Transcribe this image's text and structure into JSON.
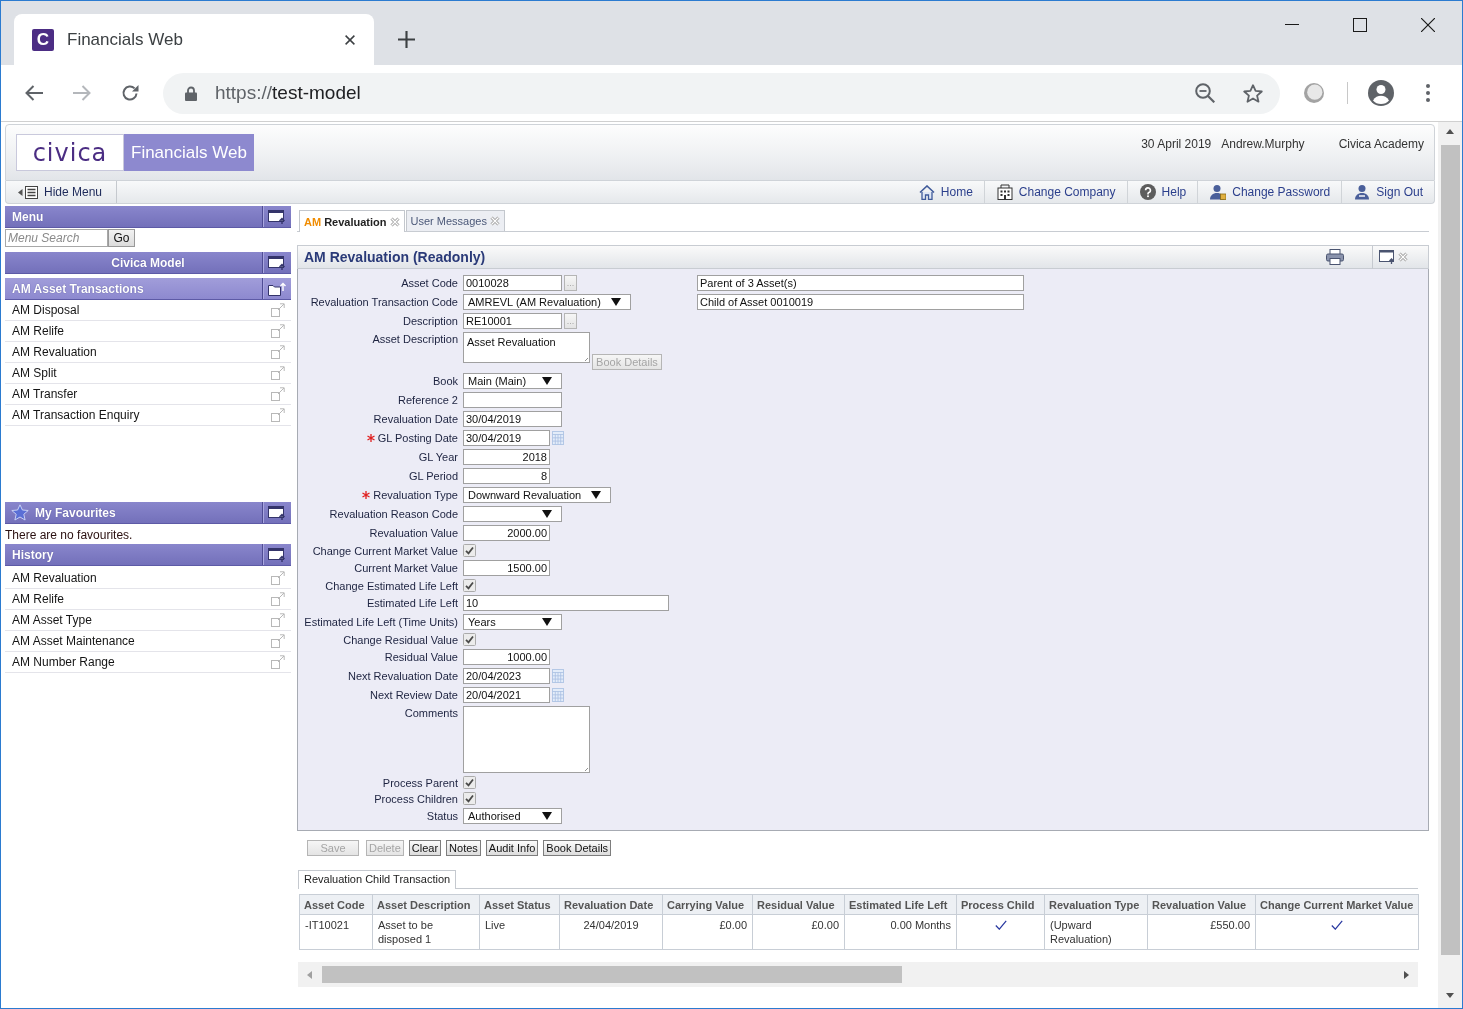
{
  "browser": {
    "tabs": [
      {
        "icon_text": "C",
        "title": "Financials Web",
        "selected": true
      }
    ],
    "url": {
      "scheme": "https://",
      "host": "test-model"
    }
  },
  "header": {
    "logo": "civica",
    "app_name": "Financials Web",
    "date": "30 April 2019",
    "user": "Andrew.Murphy",
    "organisation": "Civica Academy"
  },
  "nav": {
    "hide_menu": "Hide Menu",
    "links": [
      "Home",
      "Change Company",
      "Help",
      "Change Password",
      "Sign Out"
    ]
  },
  "sidebar": {
    "menu_title": "Menu",
    "search": {
      "placeholder": "Menu Search",
      "button": "Go"
    },
    "company": "Civica Model",
    "section": {
      "title": "AM Asset Transactions",
      "items": [
        "AM Disposal",
        "AM Relife",
        "AM Revaluation",
        "AM Split",
        "AM Transfer",
        "AM Transaction Enquiry"
      ]
    },
    "favourites": {
      "title": "My Favourites",
      "empty_text": "There are no favourites."
    },
    "history": {
      "title": "History",
      "items": [
        "AM Revaluation",
        "AM Relife",
        "AM Asset Type",
        "AM Asset Maintenance",
        "AM Number Range"
      ]
    }
  },
  "tabs": [
    {
      "prefix": "AM",
      "label": "Revaluation",
      "selected": true
    },
    {
      "label": "User Messages",
      "selected": false
    }
  ],
  "panel": {
    "title": "AM Revaluation (Readonly)",
    "info_fields": [
      "Parent of 3 Asset(s)",
      "Child of Asset 0010019"
    ],
    "fields": [
      {
        "label": "Asset Code",
        "kind": "lookup",
        "value": "0010028",
        "required": false,
        "button": {
          "label": "...",
          "disabled": true
        }
      },
      {
        "label": "Revaluation Transaction Code",
        "kind": "select",
        "value": "AMREVL (AM Revaluation)",
        "required": false
      },
      {
        "label": "Description",
        "kind": "lookup",
        "value": "RE10001",
        "required": false,
        "button": {
          "label": "...",
          "disabled": true
        }
      },
      {
        "label": "Asset Description",
        "kind": "textarea",
        "value": "Asset Revaluation",
        "required": false,
        "button": {
          "label": "Book Details",
          "disabled": true
        }
      },
      {
        "label": "Book",
        "kind": "select",
        "value": "Main (Main)",
        "required": false
      },
      {
        "label": "Reference 2",
        "kind": "text",
        "required": false
      },
      {
        "label": "Revaluation Date",
        "kind": "text",
        "value": "30/04/2019",
        "required": false
      },
      {
        "label": "GL Posting Date",
        "kind": "date",
        "value": "30/04/2019",
        "required": true
      },
      {
        "label": "GL Year",
        "kind": "number",
        "value": "2018",
        "required": false
      },
      {
        "label": "GL Period",
        "kind": "number",
        "value": "8",
        "required": false
      },
      {
        "label": "Revaluation Type",
        "kind": "select",
        "value": "Downward Revaluation",
        "required": true
      },
      {
        "label": "Revaluation Reason Code",
        "kind": "select",
        "required": false
      },
      {
        "label": "Revaluation Value",
        "kind": "number",
        "value": "2000.00",
        "required": false
      },
      {
        "label": "Change Current Market Value",
        "kind": "checkbox",
        "checked": true,
        "required": false
      },
      {
        "label": "Current Market Value",
        "kind": "number",
        "value": "1500.00",
        "required": false
      },
      {
        "label": "Change Estimated Life Left",
        "kind": "checkbox",
        "checked": true,
        "required": false
      },
      {
        "label": "Estimated Life Left",
        "kind": "longtext",
        "value": "10",
        "required": false
      },
      {
        "label": "Estimated Life Left (Time Units)",
        "kind": "select",
        "value": "Years",
        "required": false
      },
      {
        "label": "Change Residual Value",
        "kind": "checkbox",
        "checked": true,
        "required": false
      },
      {
        "label": "Residual Value",
        "kind": "number",
        "value": "1000.00",
        "required": false
      },
      {
        "label": "Next Revaluation Date",
        "kind": "date",
        "value": "20/04/2023",
        "required": false
      },
      {
        "label": "Next Review Date",
        "kind": "date",
        "value": "20/04/2021",
        "required": false
      },
      {
        "label": "Comments",
        "kind": "memo",
        "required": false
      },
      {
        "label": "Process Parent",
        "kind": "checkbox",
        "checked": true,
        "required": false
      },
      {
        "label": "Process Children",
        "kind": "checkbox",
        "checked": true,
        "required": false
      },
      {
        "label": "Status",
        "kind": "select",
        "value": "Authorised",
        "required": false
      }
    ],
    "buttons": [
      {
        "label": "Save",
        "disabled": true
      },
      {
        "label": "Delete",
        "disabled": true
      },
      {
        "label": "Clear",
        "disabled": false
      },
      {
        "label": "Notes",
        "disabled": false
      },
      {
        "label": "Audit Info",
        "disabled": false
      },
      {
        "label": "Book Details",
        "disabled": false
      }
    ]
  },
  "child_transactions": {
    "tab": "Revaluation Child Transaction",
    "table": {
      "columns": [
        "Asset Code",
        "Asset Description",
        "Asset Status",
        "Revaluation Date",
        "Carrying Value",
        "Residual Value",
        "Estimated Life Left",
        "Process Child",
        "Revaluation Type",
        "Revaluation Value",
        "Change Current Market Value"
      ],
      "rows": [
        {
          "cells": [
            {
              "kind": "text",
              "text": "-IT10021"
            },
            {
              "kind": "text",
              "text": "Asset to be disposed 1"
            },
            {
              "kind": "text",
              "text": "Live"
            },
            {
              "kind": "text",
              "text": "24/04/2019"
            },
            {
              "kind": "text",
              "text": "£0.00"
            },
            {
              "kind": "text",
              "text": "£0.00"
            },
            {
              "kind": "text",
              "text": "0.00 Months"
            },
            {
              "kind": "check",
              "checked": true
            },
            {
              "kind": "text",
              "text": "(Upward Revaluation)"
            },
            {
              "kind": "text",
              "text": "£550.00"
            },
            {
              "kind": "check",
              "checked": true
            }
          ]
        }
      ]
    }
  }
}
